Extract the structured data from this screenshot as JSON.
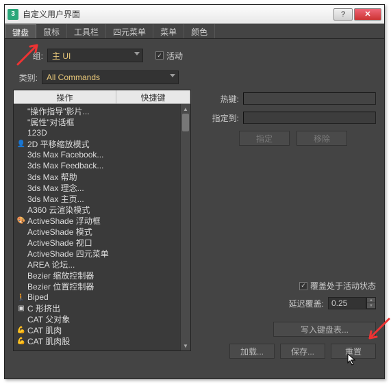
{
  "window": {
    "title": "自定义用户界面",
    "app_icon_label": "3"
  },
  "winbtns": {
    "help": "?",
    "close": "✕"
  },
  "tabs": [
    "键盘",
    "鼠标",
    "工具栏",
    "四元菜单",
    "菜单",
    "颜色"
  ],
  "active_tab": 0,
  "group_label": "组:",
  "group_value": "主 UI",
  "active_checkbox_label": "活动",
  "category_label": "类别:",
  "category_value": "All Commands",
  "list": {
    "col_action": "操作",
    "col_key": "快捷键",
    "items": [
      {
        "icon": "",
        "text": "\"操作指导\"影片..."
      },
      {
        "icon": "",
        "text": "\"属性\"对话框"
      },
      {
        "icon": "",
        "text": "123D"
      },
      {
        "icon": "person",
        "text": "2D 平移缩放模式"
      },
      {
        "icon": "",
        "text": "3ds Max Facebook..."
      },
      {
        "icon": "",
        "text": "3ds Max Feedback..."
      },
      {
        "icon": "",
        "text": "3ds Max 帮助"
      },
      {
        "icon": "",
        "text": "3ds Max 理念..."
      },
      {
        "icon": "",
        "text": "3ds Max 主页..."
      },
      {
        "icon": "",
        "text": "A360 云渲染模式"
      },
      {
        "icon": "palette",
        "text": "ActiveShade 浮动框"
      },
      {
        "icon": "",
        "text": "ActiveShade 模式"
      },
      {
        "icon": "",
        "text": "ActiveShade 视口"
      },
      {
        "icon": "",
        "text": "ActiveShade 四元菜单"
      },
      {
        "icon": "",
        "text": "AREA 论坛..."
      },
      {
        "icon": "",
        "text": "Bezier 缩放控制器"
      },
      {
        "icon": "",
        "text": "Bezier 位置控制器"
      },
      {
        "icon": "biped",
        "text": "Biped"
      },
      {
        "icon": "cube",
        "text": "C 形挤出"
      },
      {
        "icon": "",
        "text": "CAT 父对象"
      },
      {
        "icon": "muscle",
        "text": "CAT 肌肉"
      },
      {
        "icon": "muscle",
        "text": "CAT 肌肉股"
      }
    ]
  },
  "right": {
    "hotkey_label": "热键:",
    "assigned_label": "指定到:",
    "assign_btn": "指定",
    "remove_btn": "移除",
    "override_check_label": "覆盖处于活动状态",
    "delay_label": "延迟覆盖:",
    "delay_value": "0.25",
    "write_btn": "写入键盘表...",
    "load_btn": "加载...",
    "save_btn": "保存...",
    "reset_btn": "重置"
  }
}
